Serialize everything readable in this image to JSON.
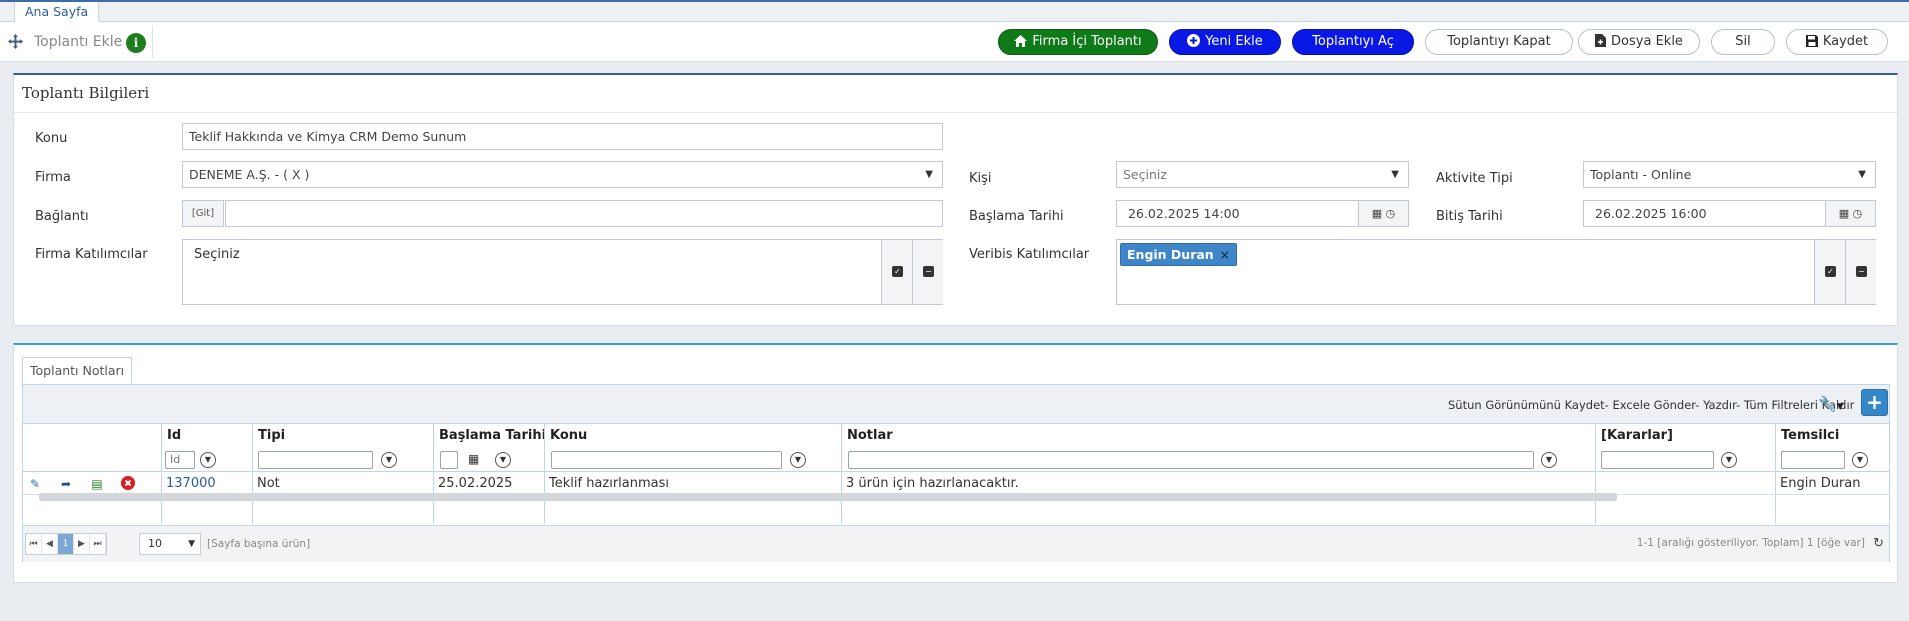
{
  "tabs": {
    "home": "Ana Sayfa"
  },
  "toolbar": {
    "title": "Toplantı Ekle",
    "info_icon": "i",
    "buttons": {
      "firma_ici": "Firma İçi Toplantı",
      "yeni_ekle": "Yeni Ekle",
      "toplantiyi_ac": "Toplantıyı Aç",
      "toplantiyi_kapat": "Toplantıyı Kapat",
      "dosya_ekle": "Dosya Ekle",
      "sil": "Sil",
      "kaydet": "Kaydet"
    },
    "colors": {
      "green": "#0f7a18",
      "blue": "#0a18e6"
    }
  },
  "form": {
    "header": "Toplantı Bilgileri",
    "konu": {
      "label": "Konu",
      "value": "Teklif Hakkında ve Kimya CRM Demo Sunum"
    },
    "firma": {
      "label": "Firma",
      "value": "DENEME A.Ş. - ( X )"
    },
    "baglanti": {
      "label": "Bağlantı",
      "git": "[Git]",
      "value": ""
    },
    "firma_katilimcilar": {
      "label": "Firma Katılımcılar",
      "value": "Seçiniz"
    },
    "kisi": {
      "label": "Kişi",
      "placeholder": "Seçiniz"
    },
    "baslama": {
      "label": "Başlama Tarihi",
      "value": "26.02.2025 14:00"
    },
    "veribis": {
      "label": "Veribis Katılımcılar",
      "tag": "Engin Duran",
      "tag_close": "×"
    },
    "aktivite": {
      "label": "Aktivite Tipi",
      "value": "Toplantı - Online"
    },
    "bitis": {
      "label": "Bitiş Tarihi",
      "value": "26.02.2025 16:00"
    }
  },
  "notes": {
    "tab": "Toplantı Notları",
    "tool_links": "Sütun Görünümünü Kaydet- Excele Gönder- Yazdır- Tüm Filtreleri Kaldır",
    "plus": "+",
    "columns": [
      "Id",
      "Tipi",
      "Başlama Tarihi",
      "Konu",
      "Notlar",
      "[Kararlar]",
      "Temsilci"
    ],
    "id_filter_placeholder": "Id",
    "rows": [
      {
        "id": "137000",
        "tipi": "Not",
        "baslama": "25.02.2025",
        "konu": "Teklif hazırlanması",
        "notlar": "3 ürün için hazırlanacaktır.",
        "kararlar": "",
        "temsilci": "Engin Duran"
      }
    ],
    "pager": {
      "current_page": "1",
      "page_size": "10",
      "per_page_text": "[Sayfa başına ürün]",
      "info": "1-1 [aralığı gösteriliyor. Toplam] 1 [öğe var]"
    }
  }
}
